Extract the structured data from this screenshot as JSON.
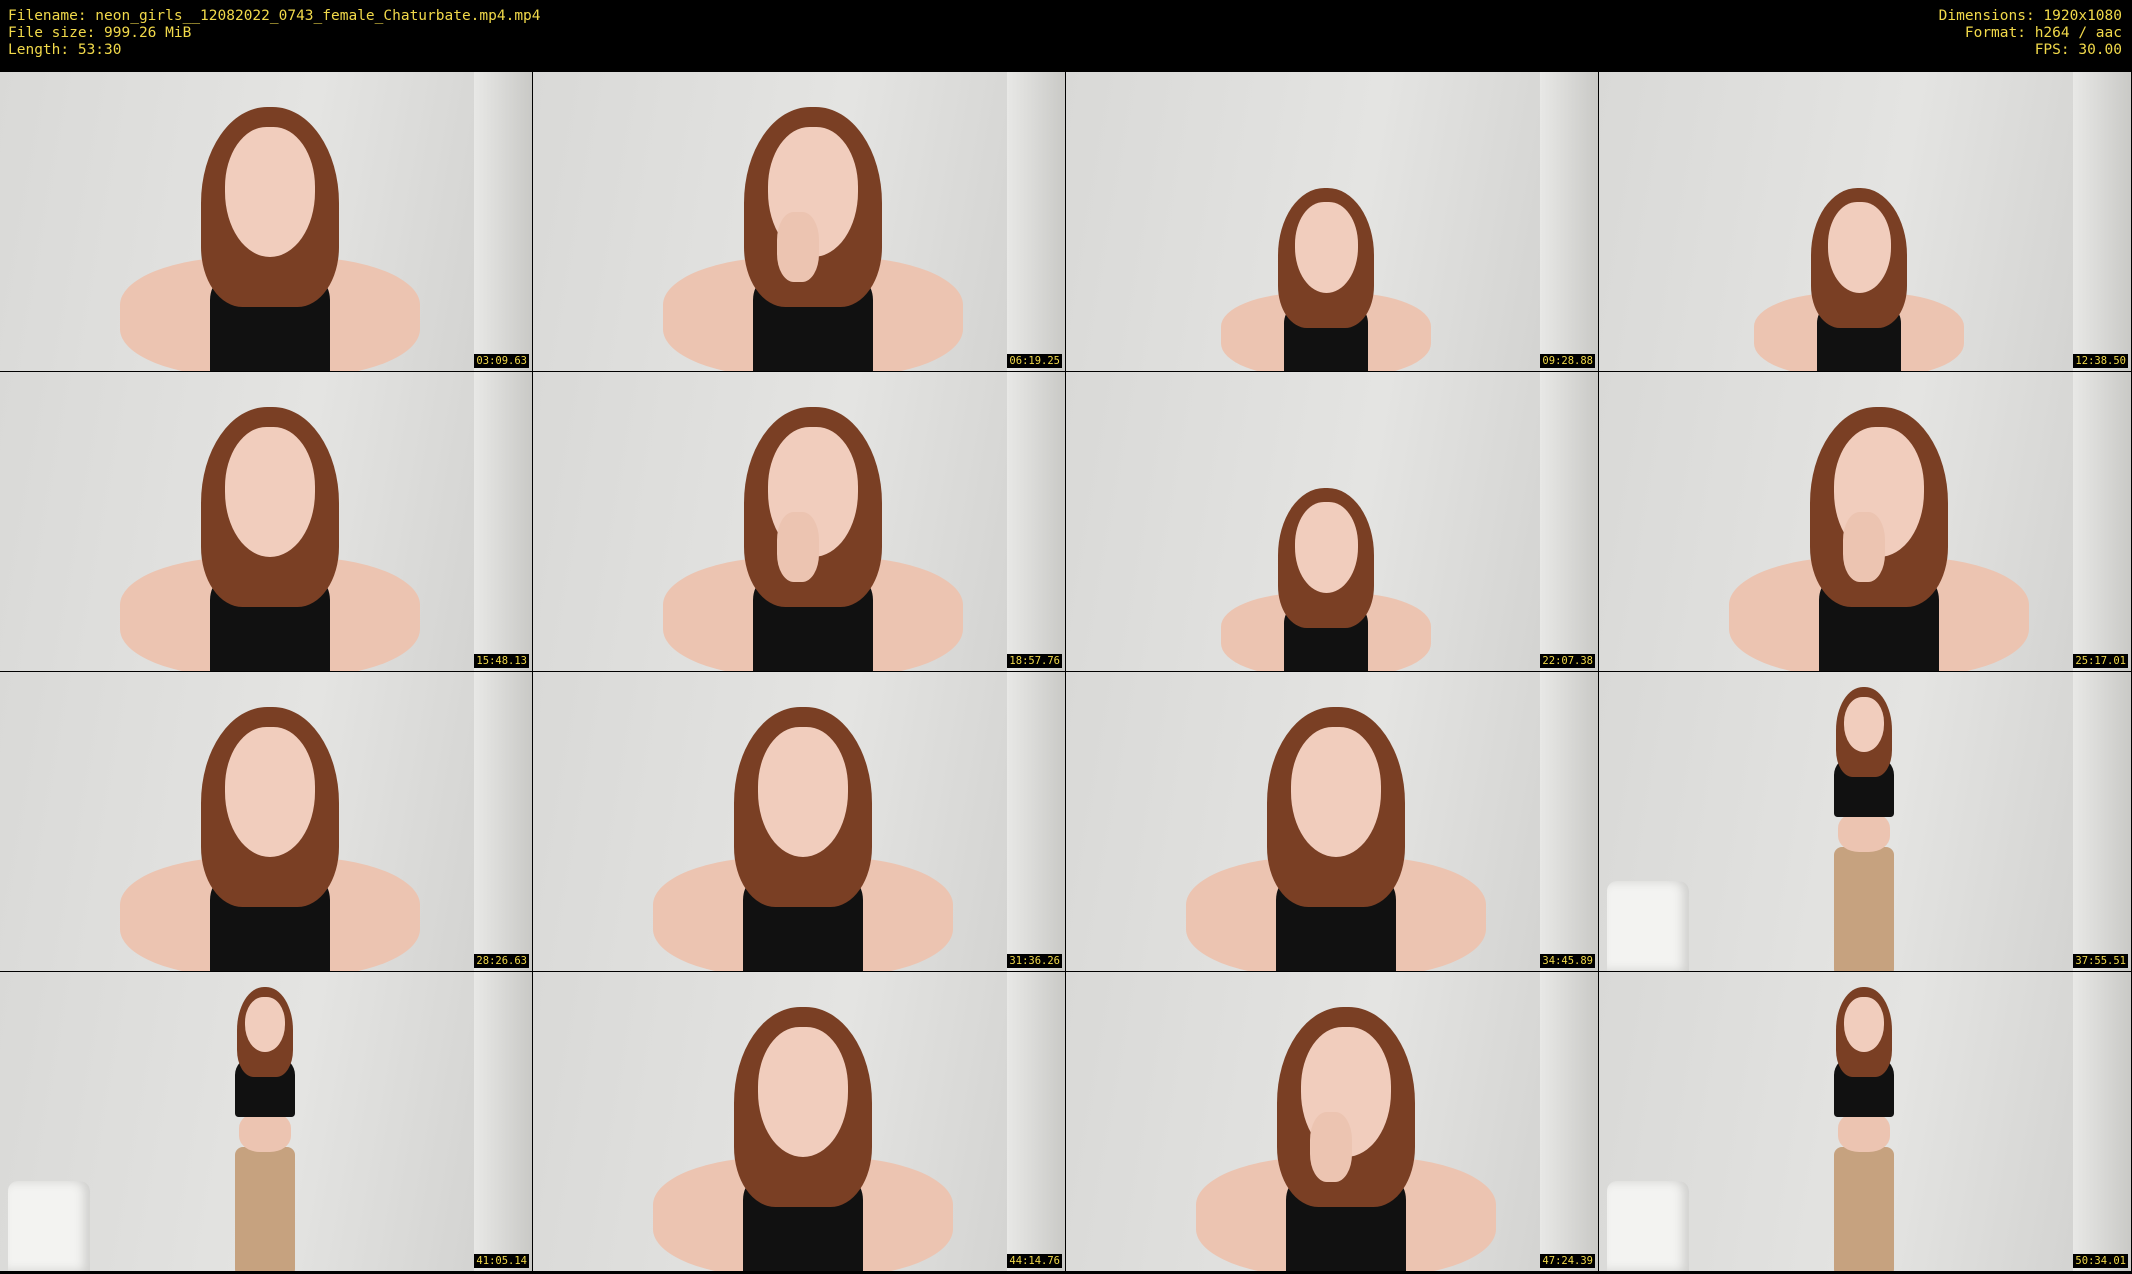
{
  "header": {
    "filename": "Filename: neon_girls__12082022_0743_female_Chaturbate.mp4.mp4",
    "filesize": "File size: 999.26 MiB",
    "length": "Length: 53:30",
    "dimensions": "Dimensions: 1920x1080",
    "format": "Format: h264 / aac",
    "fps": "FPS: 30.00"
  },
  "thumbnails": [
    {
      "timestamp": "03:09.63",
      "pose": "close"
    },
    {
      "timestamp": "06:19.25",
      "pose": "close-hand"
    },
    {
      "timestamp": "09:28.88",
      "pose": "far"
    },
    {
      "timestamp": "12:38.50",
      "pose": "far"
    },
    {
      "timestamp": "15:48.13",
      "pose": "close"
    },
    {
      "timestamp": "18:57.76",
      "pose": "close-hand"
    },
    {
      "timestamp": "22:07.38",
      "pose": "far"
    },
    {
      "timestamp": "25:17.01",
      "pose": "close-hand"
    },
    {
      "timestamp": "28:26.63",
      "pose": "close"
    },
    {
      "timestamp": "31:36.26",
      "pose": "close"
    },
    {
      "timestamp": "34:45.89",
      "pose": "close"
    },
    {
      "timestamp": "37:55.51",
      "pose": "standing"
    },
    {
      "timestamp": "41:05.14",
      "pose": "standing"
    },
    {
      "timestamp": "44:14.76",
      "pose": "close"
    },
    {
      "timestamp": "47:24.39",
      "pose": "close-hand"
    },
    {
      "timestamp": "50:34.01",
      "pose": "standing"
    }
  ]
}
